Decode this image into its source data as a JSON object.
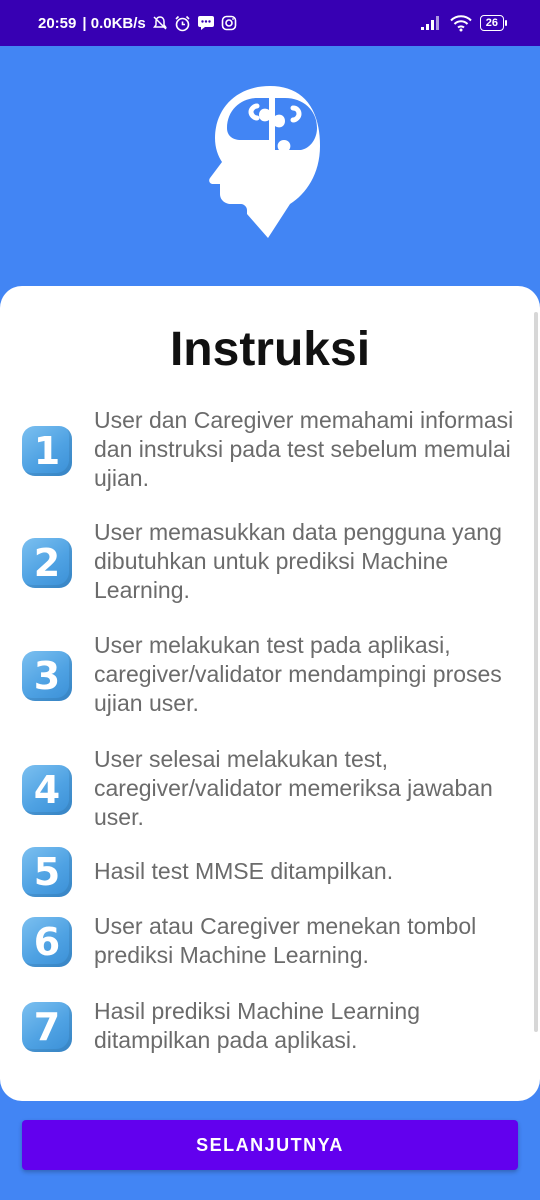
{
  "status_bar": {
    "time": "20:59",
    "speed": "| 0.0KB/s",
    "battery": "26",
    "icons": [
      "bell-off-icon",
      "alarm-icon",
      "message-icon",
      "instagram-icon",
      "signal-icon",
      "wifi-icon",
      "battery-icon"
    ]
  },
  "header": {
    "logo_icon": "brain-puzzle-head-icon"
  },
  "card": {
    "title": "Instruksi",
    "steps": [
      {
        "number": "1",
        "text": "User dan Caregiver memahami informasi dan instruksi pada test sebelum memulai ujian."
      },
      {
        "number": "2",
        "text": "User memasukkan data pengguna yang dibutuhkan untuk prediksi Machine Learning."
      },
      {
        "number": "3",
        "text": "User melakukan test pada aplikasi, caregiver/validator mendampingi proses ujian user."
      },
      {
        "number": "4",
        "text": "User selesai melakukan test, caregiver/validator memeriksa jawaban user."
      },
      {
        "number": "5",
        "text": "Hasil test MMSE ditampilkan."
      },
      {
        "number": "6",
        "text": "User atau Caregiver menekan tombol prediksi Machine Learning."
      },
      {
        "number": "7",
        "text": "Hasil prediksi Machine Learning ditampilkan pada aplikasi."
      }
    ]
  },
  "button": {
    "next_label": "SELANJUTNYA"
  },
  "colors": {
    "background": "#4285F4",
    "status_bar": "#3700B3",
    "button": "#6200EE",
    "badge": "#4FA2E3",
    "step_text": "#6b6b6b"
  }
}
